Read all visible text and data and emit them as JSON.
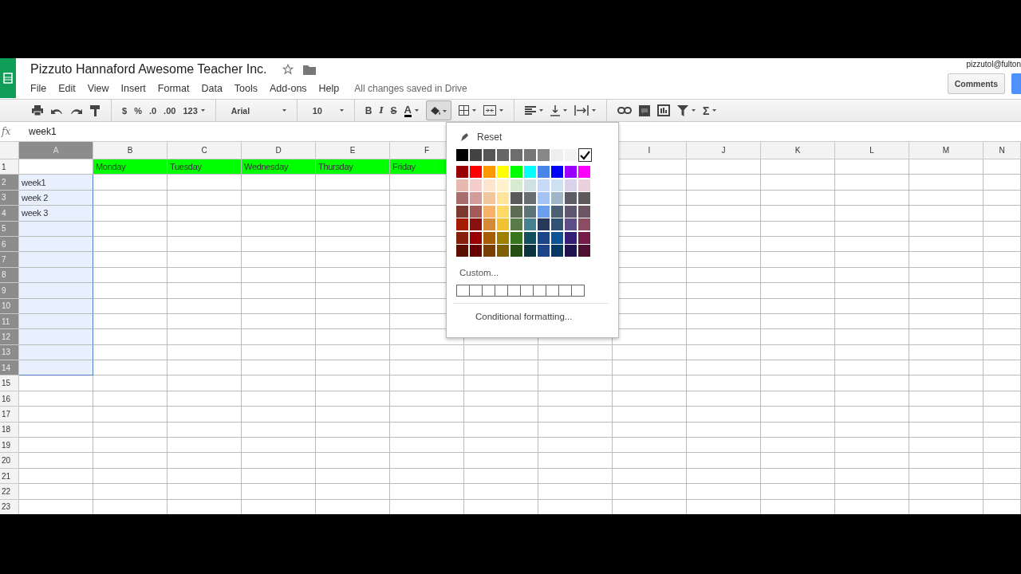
{
  "doc": {
    "title": "Pizzuto Hannaford Awesome Teacher Inc.",
    "starred": false,
    "user": "pizzutol@fulton",
    "comments_button": "Comments"
  },
  "menu": [
    "File",
    "Edit",
    "View",
    "Insert",
    "Format",
    "Data",
    "Tools",
    "Add-ons",
    "Help"
  ],
  "save_status": "All changes saved in Drive",
  "toolbar": {
    "currency": "$",
    "percent": "%",
    "decrease_decimals": ".0",
    "increase_decimals": ".00",
    "more_formats": "123",
    "font": "Arial",
    "font_size": "10",
    "bold": "B",
    "italic": "I",
    "strikethrough": "S",
    "text_color": "A",
    "sum": "Σ",
    "fill_color_open": true
  },
  "formula_bar": {
    "label": "fx",
    "value": "week1"
  },
  "columns": [
    {
      "label": "A",
      "selected": true
    },
    {
      "label": "B",
      "selected": false
    },
    {
      "label": "C",
      "selected": false
    },
    {
      "label": "D",
      "selected": false
    },
    {
      "label": "E",
      "selected": false
    },
    {
      "label": "F",
      "selected": false
    },
    {},
    {},
    {
      "label": "I",
      "selected": false
    },
    {
      "label": "J",
      "selected": false
    },
    {
      "label": "K",
      "selected": false
    },
    {
      "label": "L",
      "selected": false
    },
    {
      "label": "M",
      "selected": false
    },
    {
      "label": "N",
      "selected": false
    }
  ],
  "rows": [
    {
      "number": "1",
      "selected": false,
      "cells": [
        {},
        {
          "text": "Monday",
          "color": "#00ff00"
        },
        {
          "text": "Tuesday",
          "color": "#00ff00"
        },
        {
          "text": "Wednesday",
          "color": "#00ff00"
        },
        {
          "text": "Thursday",
          "color": "#00ff00"
        },
        {
          "text": "Friday",
          "color": "#00ff00"
        }
      ]
    },
    {
      "number": "2",
      "selected": true,
      "cells": [
        {
          "text": "week1"
        }
      ]
    },
    {
      "number": "3",
      "selected": true,
      "cells": [
        {
          "text": "week 2"
        }
      ]
    },
    {
      "number": "4",
      "selected": true,
      "cells": [
        {
          "text": "week 3"
        }
      ]
    },
    {
      "number": "5",
      "selected": true
    },
    {
      "number": "6",
      "selected": true
    },
    {
      "number": "7",
      "selected": true
    },
    {
      "number": "8",
      "selected": true
    },
    {
      "number": "9",
      "selected": true
    },
    {
      "number": "10",
      "selected": true
    },
    {
      "number": "11",
      "selected": true
    },
    {
      "number": "12",
      "selected": true
    },
    {
      "number": "13",
      "selected": true
    },
    {
      "number": "14",
      "selected": true
    },
    {
      "number": "15",
      "selected": false
    },
    {
      "number": "16",
      "selected": false
    },
    {
      "number": "17",
      "selected": false
    },
    {
      "number": "18",
      "selected": false
    },
    {
      "number": "19",
      "selected": false
    },
    {
      "number": "20",
      "selected": false
    },
    {
      "number": "21",
      "selected": false
    },
    {
      "number": "22",
      "selected": false
    },
    {
      "number": "23",
      "selected": false
    }
  ],
  "color_menu": {
    "reset": "Reset",
    "swatch_rows": [
      [
        {
          "color": "#000000",
          "selected": false
        },
        {
          "color": "#434343",
          "selected": false
        },
        {
          "color": "#555555",
          "selected": false
        },
        {
          "color": "#666666",
          "selected": false
        },
        {
          "color": "#6e6e6e",
          "selected": false
        },
        {
          "color": "#777777",
          "selected": false
        },
        {
          "color": "#888888",
          "selected": false
        },
        {
          "color": "#eeeeee",
          "selected": false
        },
        {
          "color": "#f3f3f3",
          "selected": false
        },
        {
          "color": "#ffffff",
          "selected": true
        }
      ],
      [
        {
          "color": "#980000",
          "selected": false
        },
        {
          "color": "#ff0000",
          "selected": false
        },
        {
          "color": "#ff9900",
          "selected": false
        },
        {
          "color": "#ffff00",
          "selected": false
        },
        {
          "color": "#00ff00",
          "selected": false
        },
        {
          "color": "#00ffff",
          "selected": false
        },
        {
          "color": "#4a86e8",
          "selected": false
        },
        {
          "color": "#0000ff",
          "selected": false
        },
        {
          "color": "#9900ff",
          "selected": false
        },
        {
          "color": "#ff00ff",
          "selected": false
        }
      ],
      [
        {
          "color": "#e6b8af",
          "selected": false
        },
        {
          "color": "#f4cccc",
          "selected": false
        },
        {
          "color": "#fce5cd",
          "selected": false
        },
        {
          "color": "#fff2cc",
          "selected": false
        },
        {
          "color": "#d9ead3",
          "selected": false
        },
        {
          "color": "#d0e0e3",
          "selected": false
        },
        {
          "color": "#c9daf8",
          "selected": false
        },
        {
          "color": "#cfe2f3",
          "selected": false
        },
        {
          "color": "#d9d2e9",
          "selected": false
        },
        {
          "color": "#ead1dc",
          "selected": false
        }
      ],
      [
        {
          "color": "#a86e6e",
          "selected": false
        },
        {
          "color": "#d59a9a",
          "selected": false
        },
        {
          "color": "#f2c69c",
          "selected": false
        },
        {
          "color": "#ffe599",
          "selected": false
        },
        {
          "color": "#5a5a5a",
          "selected": false
        },
        {
          "color": "#666e70",
          "selected": false
        },
        {
          "color": "#a4c2f4",
          "selected": false
        },
        {
          "color": "#9fb5c8",
          "selected": false
        },
        {
          "color": "#5d5d66",
          "selected": false
        },
        {
          "color": "#5e5a5c",
          "selected": false
        }
      ],
      [
        {
          "color": "#7a3a30",
          "selected": false
        },
        {
          "color": "#a55a5a",
          "selected": false
        },
        {
          "color": "#f6b26b",
          "selected": false
        },
        {
          "color": "#ffd966",
          "selected": false
        },
        {
          "color": "#5d6b55",
          "selected": false
        },
        {
          "color": "#5e7378",
          "selected": false
        },
        {
          "color": "#6d9eeb",
          "selected": false
        },
        {
          "color": "#4b6075",
          "selected": false
        },
        {
          "color": "#5d5870",
          "selected": false
        },
        {
          "color": "#6e5563",
          "selected": false
        }
      ],
      [
        {
          "color": "#a61c00",
          "selected": false
        },
        {
          "color": "#8a1010",
          "selected": false
        },
        {
          "color": "#d28a38",
          "selected": false
        },
        {
          "color": "#f1c232",
          "selected": false
        },
        {
          "color": "#5a7a4a",
          "selected": false
        },
        {
          "color": "#45818e",
          "selected": false
        },
        {
          "color": "#26395a",
          "selected": false
        },
        {
          "color": "#2f5275",
          "selected": false
        },
        {
          "color": "#5d4e87",
          "selected": false
        },
        {
          "color": "#8a4d63",
          "selected": false
        }
      ],
      [
        {
          "color": "#85200c",
          "selected": false
        },
        {
          "color": "#990000",
          "selected": false
        },
        {
          "color": "#a45f06",
          "selected": false
        },
        {
          "color": "#9f8000",
          "selected": false
        },
        {
          "color": "#38761d",
          "selected": false
        },
        {
          "color": "#134f5c",
          "selected": false
        },
        {
          "color": "#1c4587",
          "selected": false
        },
        {
          "color": "#0b5394",
          "selected": false
        },
        {
          "color": "#351c75",
          "selected": false
        },
        {
          "color": "#741b47",
          "selected": false
        }
      ],
      [
        {
          "color": "#5b0f00",
          "selected": false
        },
        {
          "color": "#660000",
          "selected": false
        },
        {
          "color": "#783f04",
          "selected": false
        },
        {
          "color": "#7f6000",
          "selected": false
        },
        {
          "color": "#274e13",
          "selected": false
        },
        {
          "color": "#0c343d",
          "selected": false
        },
        {
          "color": "#1c4587",
          "selected": false
        },
        {
          "color": "#073763",
          "selected": false
        },
        {
          "color": "#20124d",
          "selected": false
        },
        {
          "color": "#4c1130",
          "selected": false
        }
      ]
    ],
    "custom": "Custom...",
    "conditional": "Conditional formatting..."
  }
}
